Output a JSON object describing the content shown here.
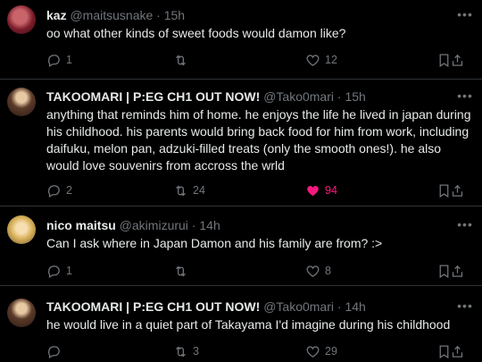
{
  "tweets": [
    {
      "display_name": "kaz",
      "handle": "@maitsusnake",
      "sep": " · ",
      "time": "15h",
      "text": "oo what other kinds of sweet foods would damon like?",
      "replies": "1",
      "retweets": "",
      "likes": "12",
      "liked": false
    },
    {
      "display_name": "TAKOOMARI | P:EG CH1 OUT NOW!",
      "handle": "@Tako0mari",
      "sep": " · ",
      "time": "15h",
      "text": "anything that reminds him of home. he enjoys the life he lived in japan during his childhood. his parents would bring back food for him from work, including daifuku, melon pan, adzuki-filled treats (only the smooth ones!). he also would love souvenirs from accross the wrld",
      "replies": "2",
      "retweets": "24",
      "likes": "94",
      "liked": true
    },
    {
      "display_name": "nico maitsu",
      "handle": "@akimizurui",
      "sep": " · ",
      "time": "14h",
      "text": "Can I ask where in Japan Damon and his family are from? :>",
      "replies": "1",
      "retweets": "",
      "likes": "8",
      "liked": false
    },
    {
      "display_name": "TAKOOMARI | P:EG CH1 OUT NOW!",
      "handle": "@Tako0mari",
      "sep": " · ",
      "time": "14h",
      "text": "he would live in a quiet part of Takayama I'd imagine during his childhood",
      "replies": "",
      "retweets": "3",
      "likes": "29",
      "liked": false
    }
  ],
  "colors": {
    "background": "#000000",
    "text": "#e7e9ea",
    "muted": "#71767b",
    "like_active": "#f91880",
    "divider": "#2f3336"
  },
  "icons": {
    "more": "more-horizontal-icon",
    "reply": "reply-icon",
    "retweet": "retweet-icon",
    "like": "heart-icon",
    "bookmark": "bookmark-icon",
    "share": "share-icon"
  }
}
